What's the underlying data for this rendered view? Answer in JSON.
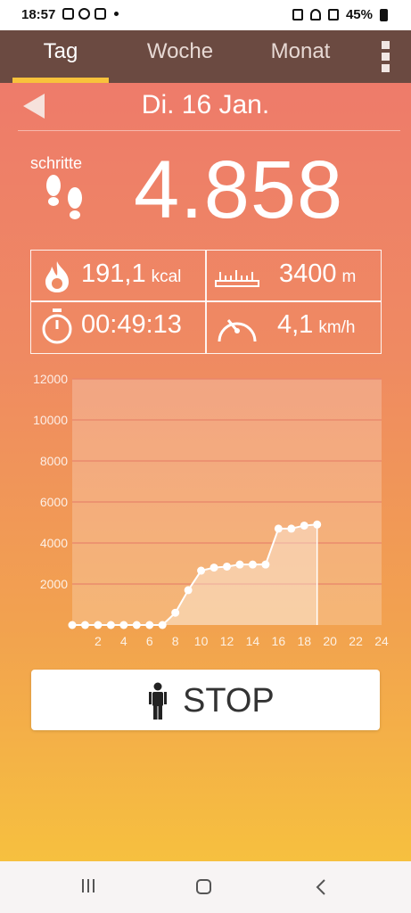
{
  "status_bar": {
    "time": "18:57",
    "battery": "45%"
  },
  "tabs": [
    {
      "label": "Tag",
      "active": true
    },
    {
      "label": "Woche",
      "active": false
    },
    {
      "label": "Monat",
      "active": false
    }
  ],
  "date": "Di. 16 Jan.",
  "steps": {
    "label": "schritte",
    "value": "4.858"
  },
  "stats": {
    "calories": {
      "value": "191,1",
      "unit": "kcal"
    },
    "distance": {
      "value": "3400",
      "unit": "m"
    },
    "duration": {
      "value": "00:49:13"
    },
    "speed": {
      "value": "4,1",
      "unit": "km/h"
    }
  },
  "stop_button": {
    "label": "STOP"
  },
  "colors": {
    "tabbar": "#6b4a41",
    "accent": "#f8c23b"
  },
  "chart_data": {
    "type": "area",
    "x": [
      0,
      1,
      2,
      3,
      4,
      5,
      6,
      7,
      8,
      9,
      10,
      11,
      12,
      13,
      14,
      15,
      16,
      17,
      18,
      19
    ],
    "values": [
      0,
      0,
      0,
      0,
      0,
      0,
      0,
      0,
      600,
      1700,
      2650,
      2800,
      2850,
      2950,
      2950,
      2950,
      4700,
      4700,
      4850,
      4900
    ],
    "xticks": [
      "2",
      "4",
      "6",
      "8",
      "10",
      "12",
      "14",
      "16",
      "18",
      "20",
      "22",
      "24"
    ],
    "yticks": [
      "2000",
      "4000",
      "6000",
      "8000",
      "10000",
      "12000"
    ],
    "xlim": [
      0,
      24
    ],
    "ylim": [
      0,
      12000
    ],
    "grid": true
  }
}
